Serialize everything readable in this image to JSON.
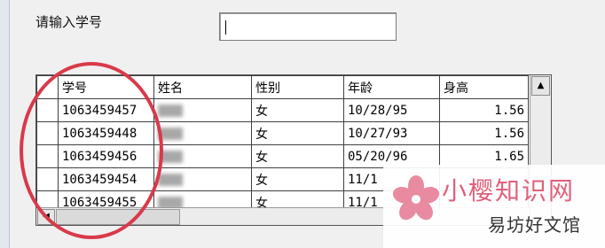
{
  "prompt_label": "请输入学号",
  "student_id_input": {
    "value": ""
  },
  "table": {
    "columns": [
      "学号",
      "姓名",
      "性别",
      "年龄",
      "身高"
    ],
    "rows": [
      {
        "id": "1063459457",
        "gender": "女",
        "date": "10/28/95",
        "height": "1.56"
      },
      {
        "id": "1063459448",
        "gender": "女",
        "date": "10/27/93",
        "height": "1.56"
      },
      {
        "id": "1063459456",
        "gender": "女",
        "date": "05/20/96",
        "height": "1.65"
      },
      {
        "id": "1063459454",
        "gender": "女",
        "date": "11/1",
        "height": ""
      },
      {
        "id": "1063459455",
        "gender": "女",
        "date": "11/1",
        "height": ""
      }
    ]
  },
  "watermark": {
    "brand": "小樱知识网",
    "subtitle": "易坊好文馆"
  },
  "colors": {
    "annotation_circle": "#d9394a",
    "watermark_brand": "#e0607a"
  }
}
